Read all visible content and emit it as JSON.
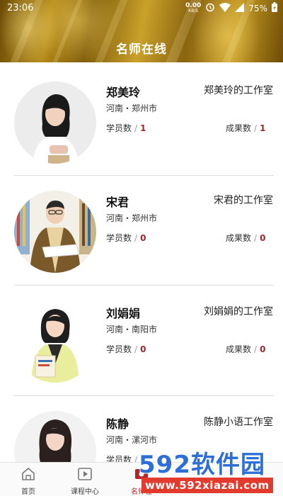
{
  "status_bar": {
    "time": "23:06",
    "speed_value": "0.00",
    "speed_unit": "KB/S",
    "battery": "75%"
  },
  "header": {
    "title": "名师在线"
  },
  "teachers": [
    {
      "name": "郑美玲",
      "studio": "郑美玲的工作室",
      "location": "河南・郑州市",
      "students_label": "学员数",
      "students": "1",
      "results_label": "成果数",
      "results": "1"
    },
    {
      "name": "宋君",
      "studio": "宋君的工作室",
      "location": "河南・郑州市",
      "students_label": "学员数",
      "students": "0",
      "results_label": "成果数",
      "results": "0"
    },
    {
      "name": "刘娟娟",
      "studio": "刘娟娟的工作室",
      "location": "河南・南阳市",
      "students_label": "学员数",
      "students": "0",
      "results_label": "成果数",
      "results": "0"
    },
    {
      "name": "陈静",
      "studio": "陈静小语工作室",
      "location": "河南・漯河市",
      "students_label": "学员数",
      "students": "",
      "results_label": "",
      "results": ""
    }
  ],
  "stat_separator": "/",
  "bottom_nav": [
    {
      "label": "首页",
      "icon": "home-icon"
    },
    {
      "label": "课程中心",
      "icon": "course-play-icon"
    },
    {
      "label": "名师在",
      "icon": "teacher-online-icon",
      "active": true
    }
  ],
  "watermark": {
    "logo": "592软件园",
    "url": "www.592xiazai.com"
  },
  "colors": {
    "accent": "#a1262b",
    "header_gold": "#b48a17"
  }
}
